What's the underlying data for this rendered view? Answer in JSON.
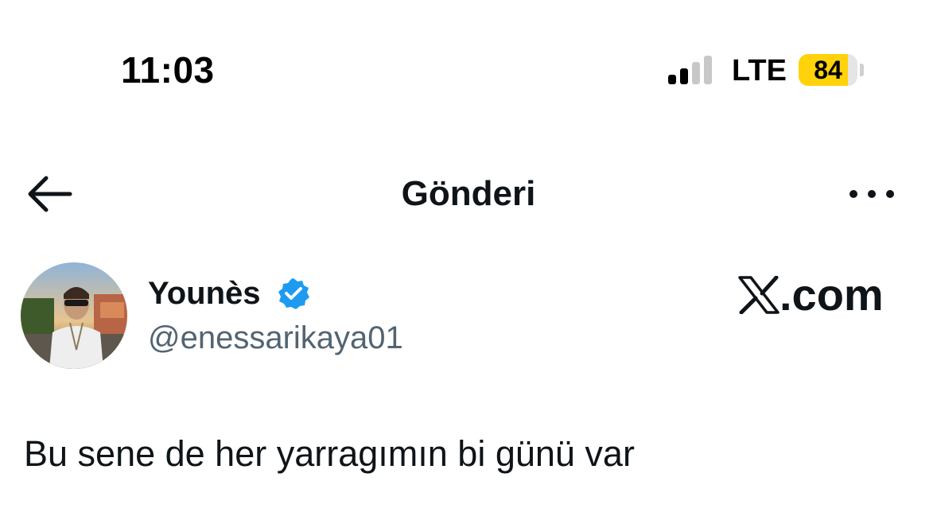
{
  "status_bar": {
    "time": "11:03",
    "network": "LTE",
    "battery_level": "84",
    "battery_fraction": 0.84,
    "signal_bars_active": 2,
    "signal_bars_total": 4
  },
  "header": {
    "title": "Gönderi",
    "back_icon": "arrow-left-icon",
    "more_icon": "more-horizontal-icon"
  },
  "post": {
    "author_name": "Younès",
    "author_handle": "@enessarikaya01",
    "verified": true,
    "verified_color": "#1d9bf0",
    "brand_label": ".com",
    "brand_icon": "x-logo-icon",
    "text": "Bu sene de her yarragımın bi günü var"
  },
  "colors": {
    "accent_battery": "#ffd20a",
    "secondary_text": "#536471",
    "primary_text": "#0f1419"
  }
}
